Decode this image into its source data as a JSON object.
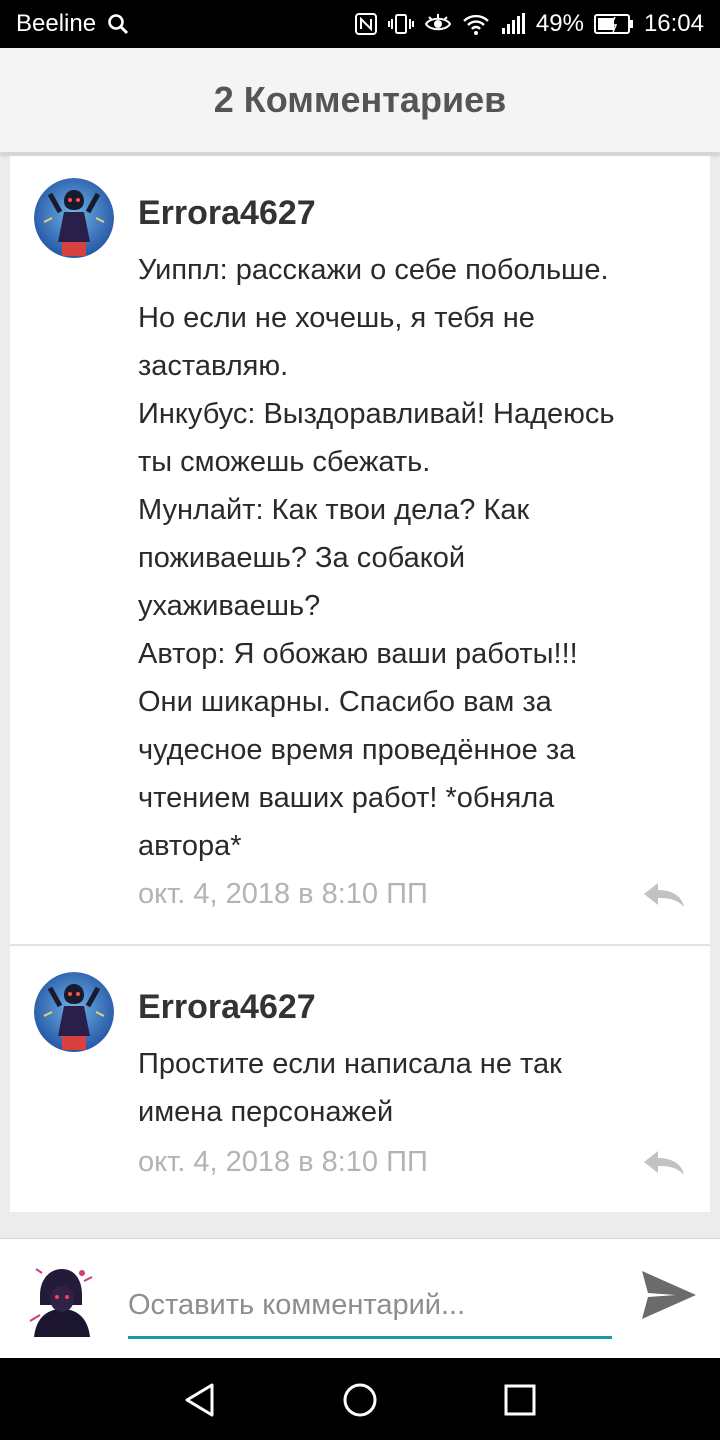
{
  "status_bar": {
    "carrier": "Beeline",
    "battery": "49%",
    "time": "16:04"
  },
  "header": {
    "title": "2 Комментариев"
  },
  "comments": [
    {
      "username": "Errora4627",
      "lines": [
        "Уиппл: расскажи о себе побольше.",
        "Но если не хочешь,  я тебя не",
        "заставляю.",
        "Инкубус: Выздоравливай!  Надеюсь",
        "ты сможешь сбежать.",
        "Мунлайт: Как твои дела?  Как",
        "поживаешь?  За собакой",
        "ухаживаешь?",
        "Автор: Я обожаю ваши работы!!!",
        "Они шикарны.  Спасибо вам за",
        "чудесное время проведённое за",
        "чтением ваших работ!  *обняла",
        "автора*"
      ],
      "timestamp": "окт. 4, 2018 в 8:10 ПП"
    },
    {
      "username": "Errora4627",
      "lines": [
        "Простите если написала не так",
        "имена персонажей"
      ],
      "timestamp": "окт. 4, 2018 в 8:10 ПП"
    }
  ],
  "composer": {
    "placeholder": "Оставить комментарий..."
  },
  "colors": {
    "accent": "#1a9aa8",
    "timestamp": "#b3b3b3",
    "header_bg": "#f4f4f4"
  },
  "icons": [
    "search-icon",
    "nfc-icon",
    "vibrate-icon",
    "eye-icon",
    "wifi-icon",
    "signal-icon",
    "battery-icon",
    "reply-icon",
    "send-icon",
    "back-icon",
    "home-icon",
    "recents-icon"
  ]
}
